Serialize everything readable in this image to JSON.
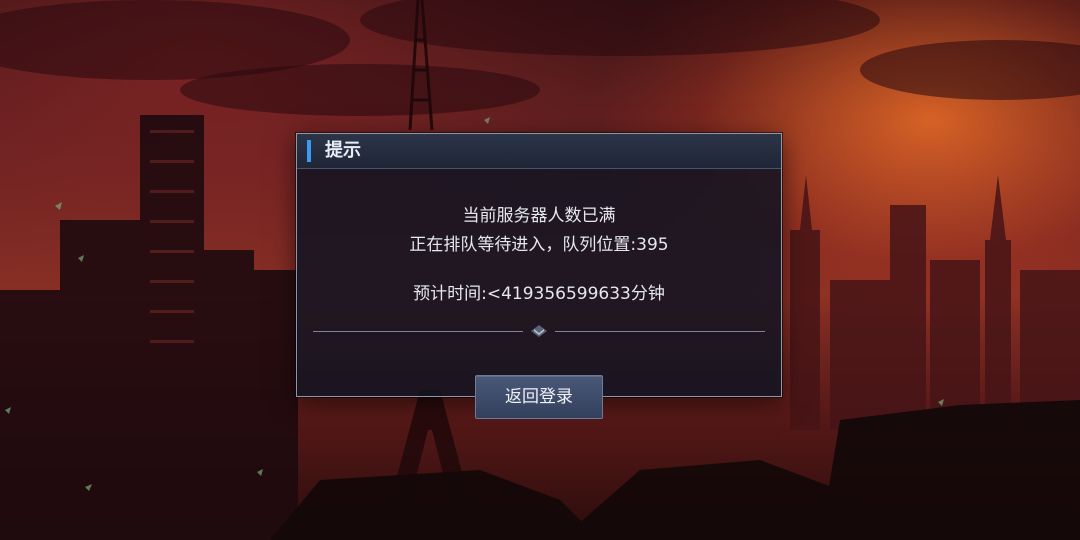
{
  "dialog": {
    "title": "提示",
    "message_line1": "当前服务器人数已满",
    "message_line2": "正在排队等待进入，队列位置:395",
    "estimated_time": "预计时间:<419356599633分钟",
    "return_button_label": "返回登录"
  },
  "colors": {
    "accent": "#3a9cf0",
    "dialog_bg": "#101422",
    "button_bg": "#3c4a68"
  }
}
